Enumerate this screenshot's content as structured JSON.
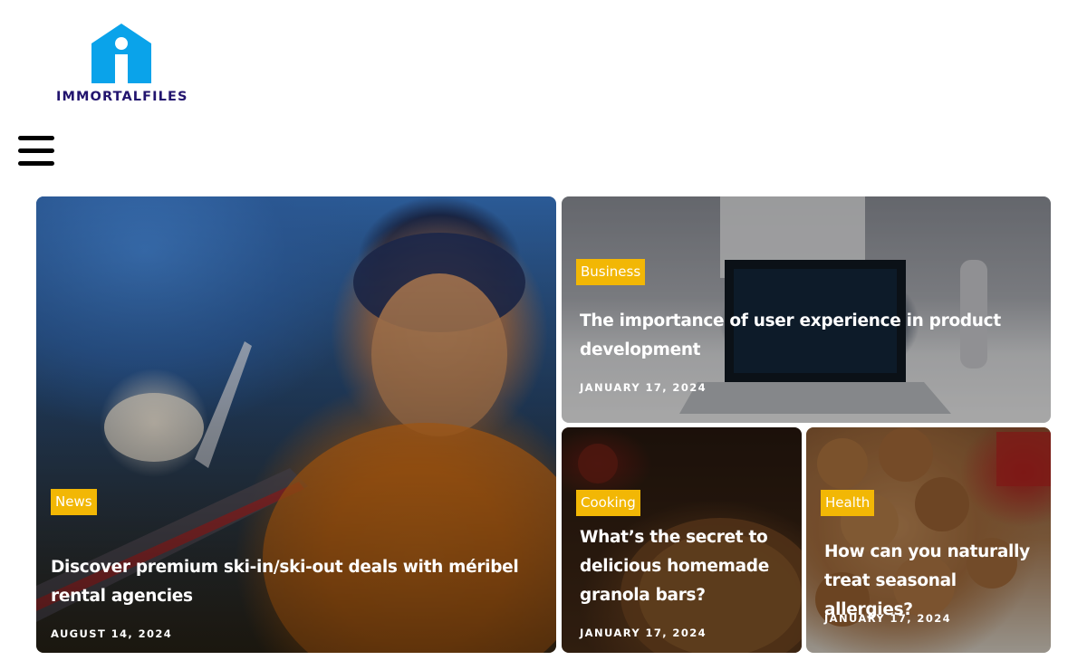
{
  "brand": {
    "name": "IMMORTALFILES",
    "logo_icon": "house-i-logo",
    "logo_color": "#0aa3ea",
    "text_color": "#22146e"
  },
  "menu": {
    "icon": "hamburger-menu-icon"
  },
  "accent_color": "#f2b705",
  "posts": [
    {
      "category": "News",
      "title": "Discover premium ski-in/ski-out deals with méribel rental agencies",
      "date": "AUGUST 14, 2024"
    },
    {
      "category": "Business",
      "title": "The importance of user experience in product development",
      "date": "JANUARY 17, 2024"
    },
    {
      "category": "Cooking",
      "title": "What’s the secret to delicious homemade granola bars?",
      "date": "JANUARY 17, 2024"
    },
    {
      "category": "Health",
      "title": "How can you naturally treat seasonal allergies?",
      "date": "JANUARY 17, 2024"
    }
  ]
}
